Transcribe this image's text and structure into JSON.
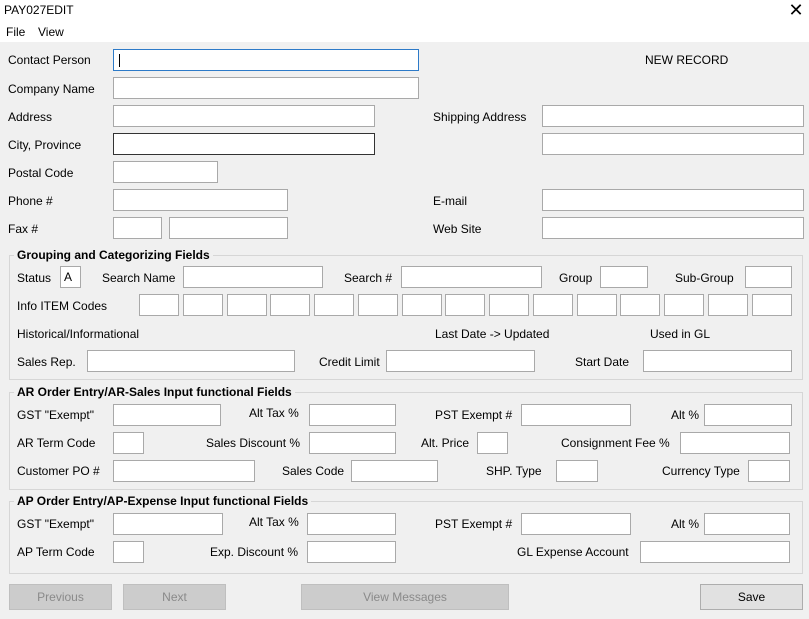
{
  "window": {
    "title": "PAY027EDIT",
    "close_glyph": "✕"
  },
  "menu": {
    "file": "File",
    "view": "View"
  },
  "record_status": "NEW RECORD",
  "contact": {
    "contact_person": "Contact Person",
    "company_name": "Company Name",
    "address": "Address",
    "city_province": "City, Province",
    "postal_code": "Postal Code",
    "phone": "Phone #",
    "fax": "Fax #",
    "shipping_address": "Shipping Address",
    "email": "E-mail",
    "website": "Web Site"
  },
  "grouping": {
    "title": "Grouping and Categorizing Fields",
    "status_label": "Status",
    "status_value": "A",
    "search_name": "Search Name",
    "search_num": "Search #",
    "group": "Group",
    "sub_group": "Sub-Group",
    "info_item_codes": "Info ITEM Codes",
    "historical": "Historical/Informational",
    "last_date_updated": "Last Date -> Updated",
    "used_in_gl": "Used in GL",
    "sales_rep": "Sales Rep.",
    "credit_limit": "Credit Limit",
    "start_date": "Start Date"
  },
  "ar": {
    "title": "AR  Order Entry/AR-Sales Input functional Fields",
    "gst_exempt": "GST \"Exempt\"",
    "alt_tax": "Alt Tax %",
    "pst_exempt": "PST Exempt #",
    "alt_pct": "Alt %",
    "term_code": "AR Term Code",
    "sales_discount": "Sales Discount %",
    "alt_price": "Alt. Price",
    "consignment_fee": "Consignment Fee %",
    "customer_po": "Customer PO #",
    "sales_code": "Sales Code",
    "shp_type": "SHP. Type",
    "currency_type": "Currency Type"
  },
  "ap": {
    "title": "AP   Order Entry/AP-Expense Input functional Fields",
    "gst_exempt": "GST \"Exempt\"",
    "alt_tax": "Alt Tax %",
    "pst_exempt": "PST Exempt #",
    "alt_pct": "Alt %",
    "term_code": "AP Term Code",
    "exp_discount": "Exp. Discount %",
    "gl_expense": "GL Expense Account"
  },
  "buttons": {
    "previous": "Previous",
    "next": "Next",
    "view_messages": "View Messages",
    "save": "Save"
  }
}
